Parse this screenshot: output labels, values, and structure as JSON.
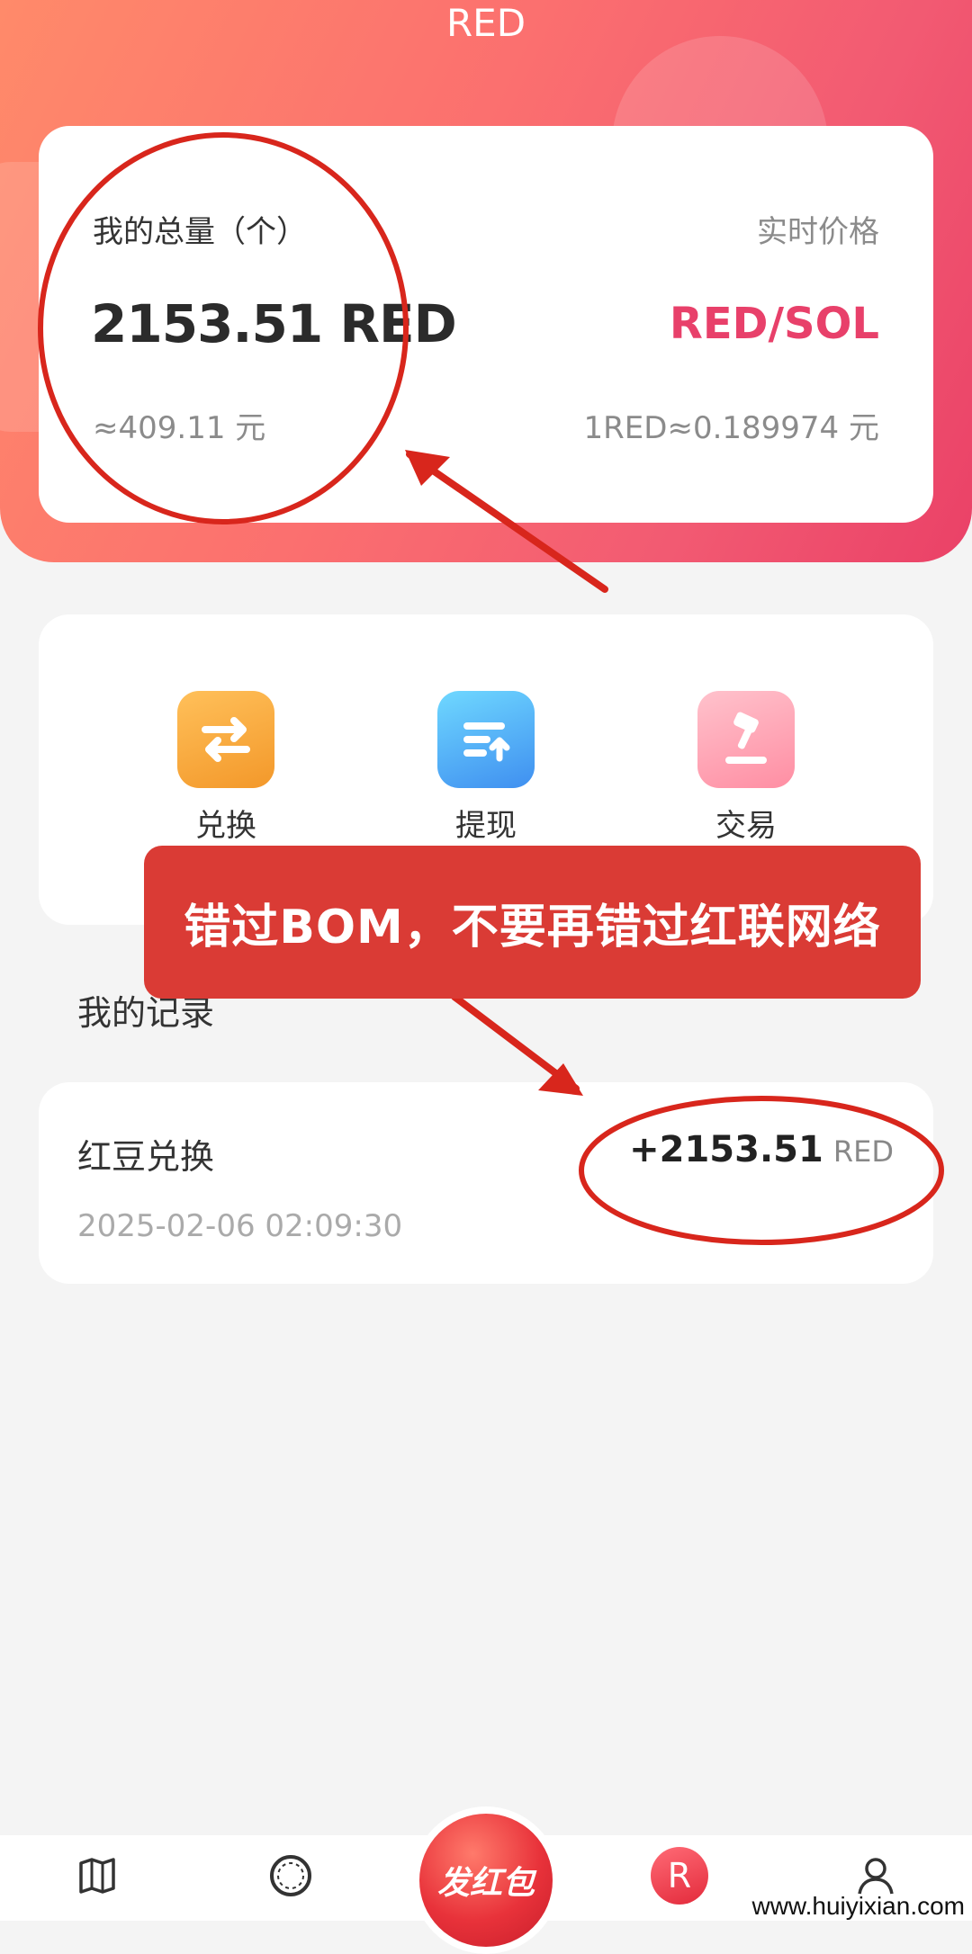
{
  "header": {
    "title": "RED"
  },
  "balance": {
    "total_label": "我的总量（个）",
    "total_value": "2153.51 RED",
    "cny_value": "≈409.11 元",
    "price_label": "实时价格",
    "pair": "RED/SOL",
    "rate": "1RED≈0.189974 元"
  },
  "actions": [
    {
      "label": "兑换",
      "icon": "exchange-icon",
      "color": "#f5a33a"
    },
    {
      "label": "提现",
      "icon": "withdraw-icon",
      "color": "#45b1f6"
    },
    {
      "label": "交易",
      "icon": "auction-hammer-icon",
      "color": "#ff98aa"
    }
  ],
  "records": {
    "title": "我的记录",
    "items": [
      {
        "name": "红豆兑换",
        "time": "2025-02-06 02:09:30",
        "amount": "+2153.51",
        "unit": "RED"
      }
    ]
  },
  "overlay": {
    "banner_text": "错过BOM，不要再错过红联网络"
  },
  "nav": {
    "center_label": "发红包",
    "r_badge": "R"
  },
  "watermark": "www.huiyixian.com",
  "colors": {
    "accent": "#e8406a",
    "annotation": "#d8261c"
  }
}
